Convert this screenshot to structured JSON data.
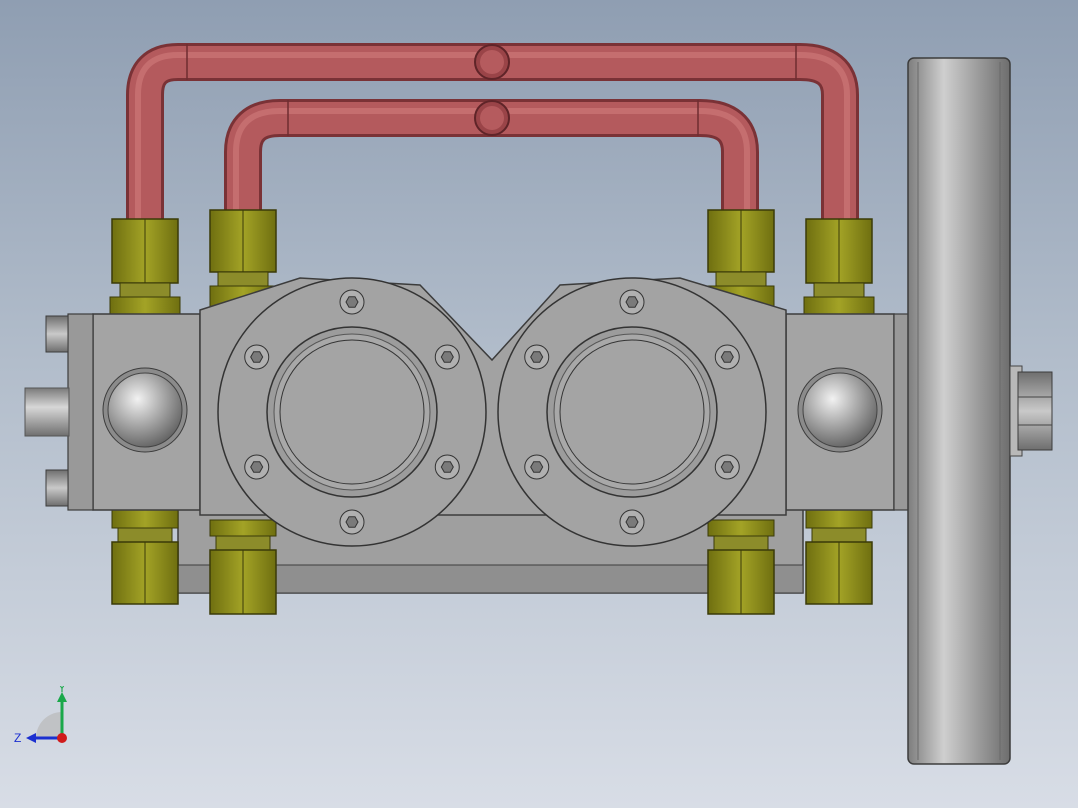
{
  "viewport": {
    "background_top": "#8f9eb2",
    "background_bottom": "#d8dde6"
  },
  "model": {
    "pipe_color": "#b5575a",
    "fitting_color": "#8e8e1a",
    "body_color": "#a2a2a2",
    "flywheel_color": "#9a9a9a"
  },
  "triad": {
    "y_label": "Y",
    "z_label": "Z",
    "y_color": "#1aa84a",
    "z_color": "#1b2fd0",
    "x_color": "#d01b1b"
  }
}
